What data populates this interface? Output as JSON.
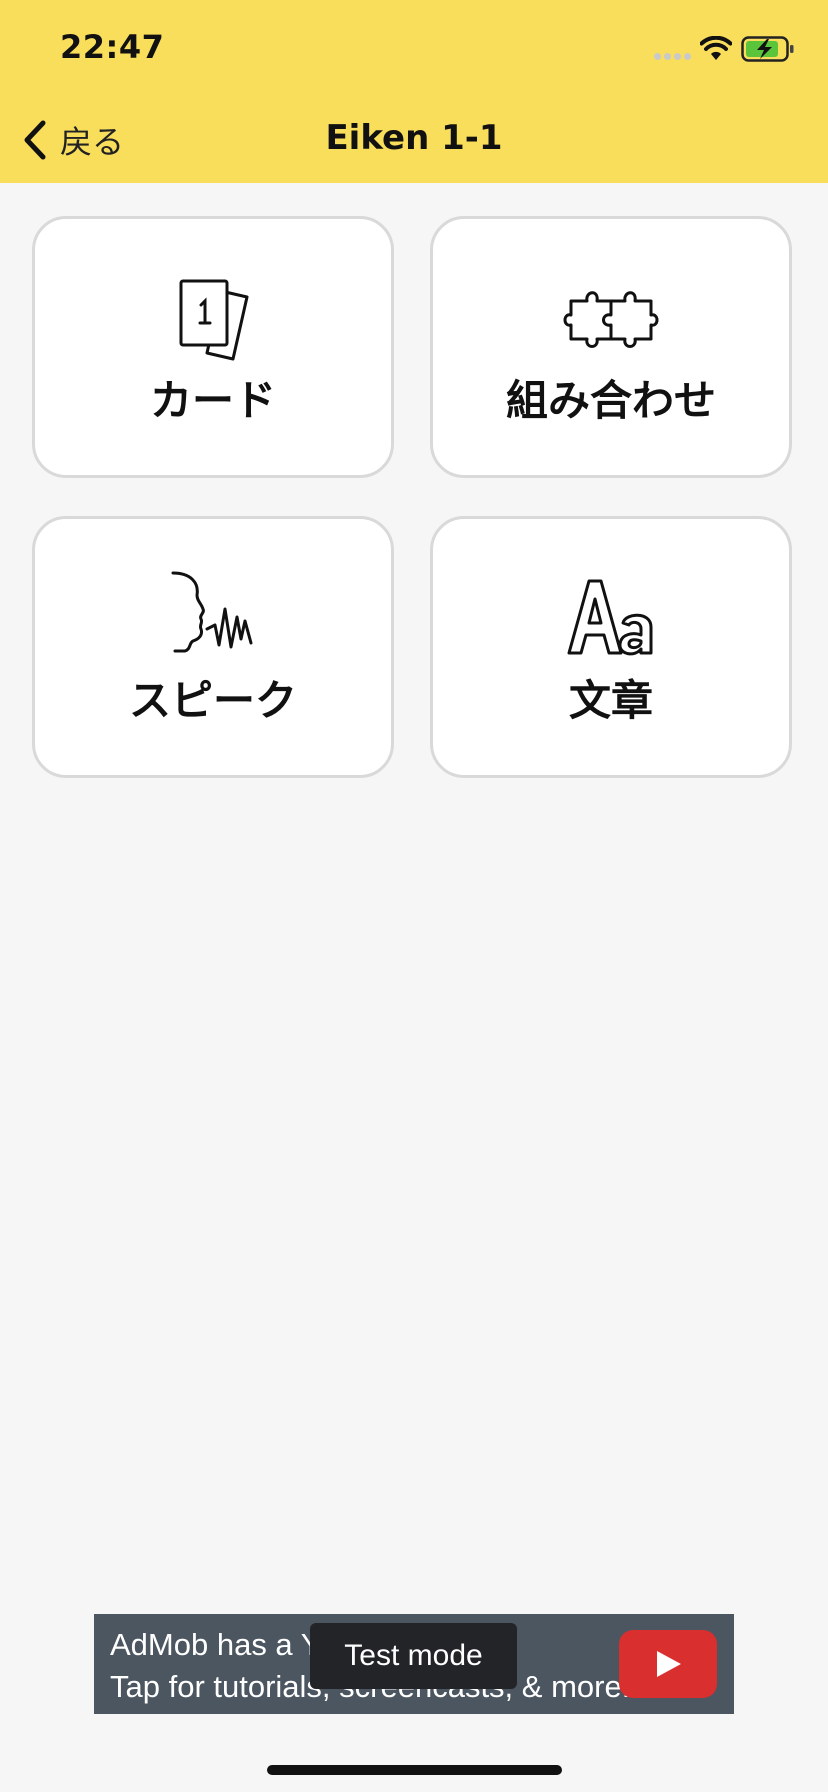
{
  "status_bar": {
    "time": "22:47",
    "icons": [
      "signal-icon",
      "wifi-icon",
      "battery-charging-icon"
    ]
  },
  "nav": {
    "back_label": "戻る",
    "title": "Eiken 1-1",
    "accent_color": "#f9de5c"
  },
  "tiles": [
    {
      "label": "カード",
      "icon": "flashcard-icon"
    },
    {
      "label": "組み合わせ",
      "icon": "puzzle-icon"
    },
    {
      "label": "スピーク",
      "icon": "speaking-face-icon"
    },
    {
      "label": "文章",
      "icon": "text-aa-icon"
    }
  ],
  "ad": {
    "line1": "AdMob has a Yo",
    "line2": "Tap for tutorials, screencasts, & more.",
    "badge": "Test mode",
    "icon": "youtube-play-icon"
  }
}
